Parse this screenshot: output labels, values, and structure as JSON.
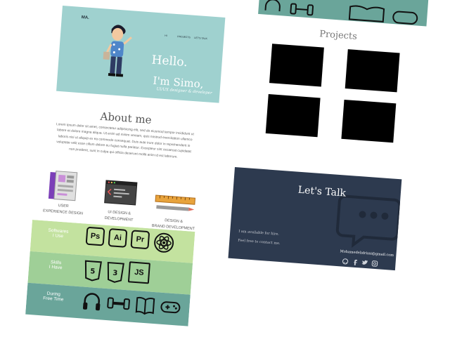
{
  "hero": {
    "logo": "MA.",
    "nav": [
      "HI",
      "PROJECTS",
      "LET'S TALK"
    ],
    "greeting": "Hello.",
    "intro": "I'm Simo,",
    "role": "UI/UX designer & developer",
    "bg_color": "#9fd1cf"
  },
  "about": {
    "title": "About me",
    "body": "Lorem ipsum dolor sit amet, consectetur adipisicing elit, sed do eiusmod tempor incididunt ut labore et dolore magna aliqua. Ut enim ad minim veniam, quis nostrud exercitation ullamco laboris nisi ut aliquip ex ea commodo consequat. Duis aute irure dolor in reprehenderit in voluptate velit esse cillum dolore eu fugiat nulla pariatur. Excepteur sint occaecat cupidatat non proident, sunt in culpa qui officia deserunt mollit anim id est laborum."
  },
  "services": [
    {
      "line1": "USER",
      "line2": "EXPERIENCE DESIGN",
      "icon": "ux-design-icon"
    },
    {
      "line1": "UI DESIGN &",
      "line2": "DEVELOPMENT",
      "icon": "code-window-icon"
    },
    {
      "line1": "DESIGN &",
      "line2": "BRAND DEVELOPMENT",
      "icon": "ruler-pencil-icon"
    }
  ],
  "skills": [
    {
      "label1": "Softwares",
      "label2": "I Use",
      "color": "#c3e29f",
      "items": [
        "Ps",
        "Ai",
        "Pr",
        "atom-icon"
      ]
    },
    {
      "label1": "Skills",
      "label2": "I Have",
      "color": "#9fcf97",
      "items": [
        "html5-icon",
        "css3-icon",
        "JS"
      ]
    },
    {
      "label1": "During",
      "label2": "Free Time",
      "color": "#6aa59a",
      "items": [
        "headphones-icon",
        "dumbbell-icon",
        "book-icon",
        "gamepad-icon"
      ]
    }
  ],
  "projects": {
    "title": "Projects"
  },
  "contact": {
    "title": "Let's Talk",
    "line1": "I am available for hire.",
    "line2": "Feel free to contact me.",
    "email": "Mohamedelidrissi@gmail.com",
    "social": [
      "github-icon",
      "facebook-icon",
      "twitter-icon",
      "instagram-icon"
    ],
    "bg_color": "#2d3a4f"
  }
}
